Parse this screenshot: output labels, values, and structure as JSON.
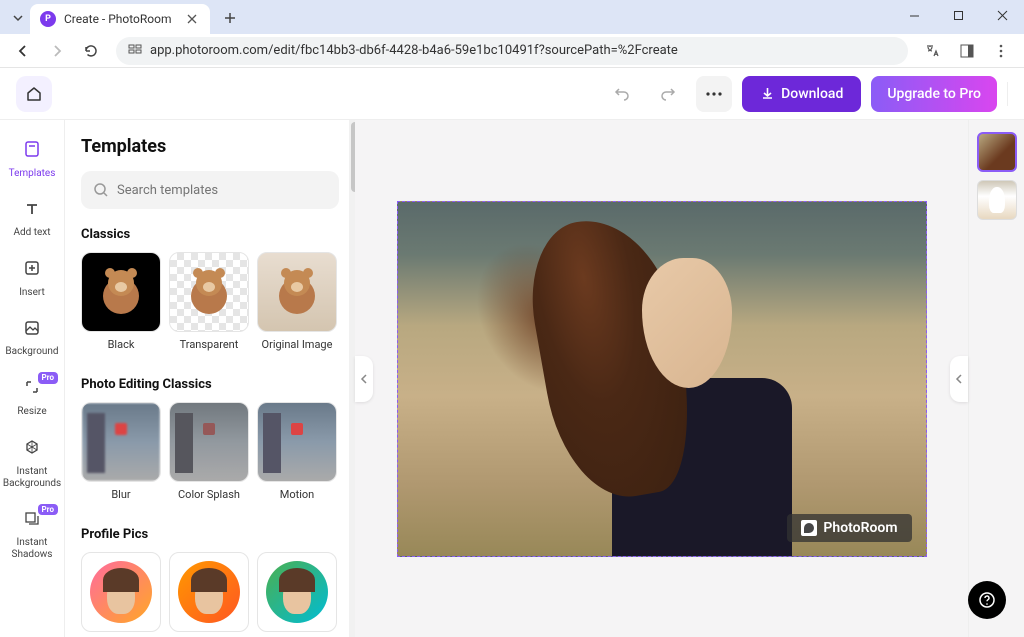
{
  "browser": {
    "tab_title": "Create - PhotoRoom",
    "url": "app.photoroom.com/edit/fbc14bb3-db6f-4428-b4a6-59e1bc10491f?sourcePath=%2Fcreate"
  },
  "topbar": {
    "download_label": "Download",
    "upgrade_label": "Upgrade to Pro"
  },
  "leftbar": {
    "templates": "Templates",
    "add_text": "Add text",
    "insert": "Insert",
    "background": "Background",
    "resize": "Resize",
    "instant_bg": "Instant Backgrounds",
    "instant_shadows": "Instant Shadows",
    "pro_badge": "Pro"
  },
  "templates_panel": {
    "title": "Templates",
    "search_placeholder": "Search templates",
    "sections": {
      "classics": {
        "label": "Classics",
        "items": [
          {
            "label": "Black"
          },
          {
            "label": "Transparent"
          },
          {
            "label": "Original Image"
          }
        ]
      },
      "photo_editing": {
        "label": "Photo Editing Classics",
        "items": [
          {
            "label": "Blur"
          },
          {
            "label": "Color Splash"
          },
          {
            "label": "Motion"
          }
        ]
      },
      "profile_pics": {
        "label": "Profile Pics"
      }
    }
  },
  "canvas": {
    "watermark": "PhotoRoom"
  }
}
